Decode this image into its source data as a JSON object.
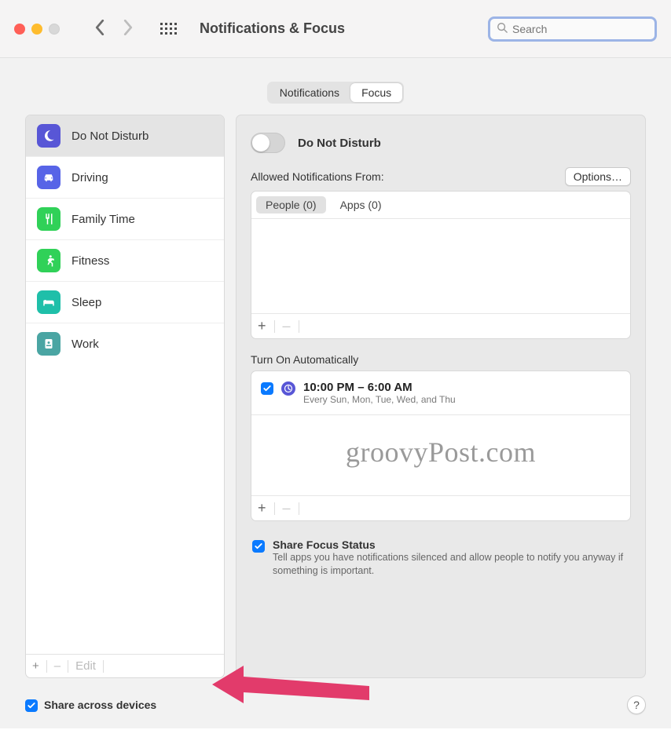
{
  "toolbar": {
    "title": "Notifications & Focus",
    "search_placeholder": "Search"
  },
  "tabs": {
    "notifications": "Notifications",
    "focus": "Focus"
  },
  "focus_modes": [
    {
      "label": "Do Not Disturb",
      "icon": "moon",
      "color": "ic-purple",
      "selected": true
    },
    {
      "label": "Driving",
      "icon": "car",
      "color": "ic-blue",
      "selected": false
    },
    {
      "label": "Family Time",
      "icon": "fork",
      "color": "ic-green",
      "selected": false
    },
    {
      "label": "Fitness",
      "icon": "runner",
      "color": "ic-green",
      "selected": false
    },
    {
      "label": "Sleep",
      "icon": "bed",
      "color": "ic-teal",
      "selected": false
    },
    {
      "label": "Work",
      "icon": "badge",
      "color": "ic-slate",
      "selected": false
    }
  ],
  "sidebar_footer": {
    "add": "+",
    "remove": "–",
    "edit": "Edit"
  },
  "detail": {
    "toggle_label": "Do Not Disturb",
    "toggle_on": false,
    "allowed_label": "Allowed Notifications From:",
    "options_btn": "Options…",
    "people_tab": "People (0)",
    "apps_tab": "Apps (0)",
    "auto_label": "Turn On Automatically",
    "schedule": {
      "enabled": true,
      "time_range": "10:00 PM – 6:00 AM",
      "days": "Every Sun, Mon, Tue, Wed, and Thu"
    },
    "share_status": {
      "enabled": true,
      "heading": "Share Focus Status",
      "desc": "Tell apps you have notifications silenced and allow people to notify you anyway if something is important."
    }
  },
  "footer": {
    "share_devices_enabled": true,
    "share_devices_label": "Share across devices",
    "help": "?"
  },
  "watermark": "groovyPost.com"
}
